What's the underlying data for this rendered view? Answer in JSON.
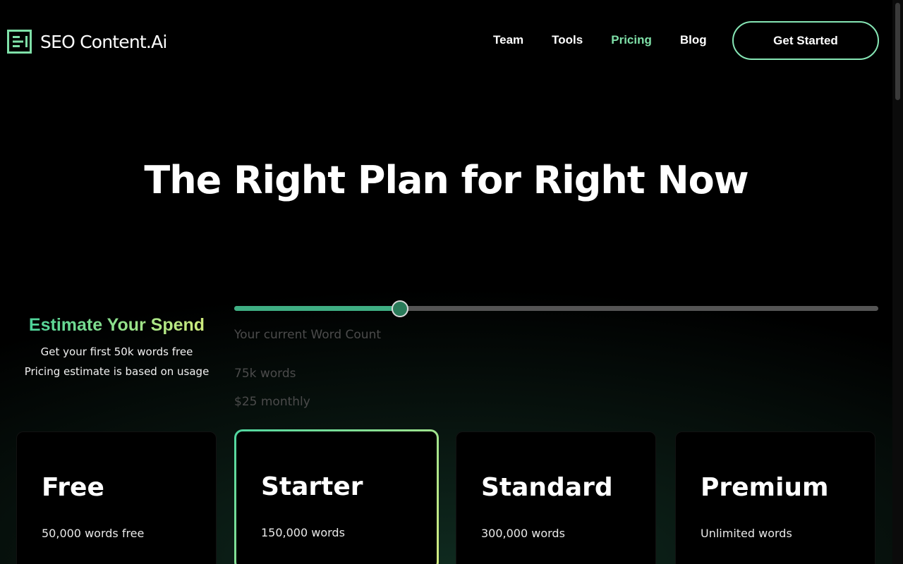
{
  "brand": {
    "name": "SEO Content.Ai",
    "accent": "#7fe0a8",
    "gradient_start": "#4dd39a",
    "gradient_end": "#cfec7e"
  },
  "nav": {
    "links": [
      {
        "label": "Team",
        "active": false
      },
      {
        "label": "Tools",
        "active": false
      },
      {
        "label": "Pricing",
        "active": true
      },
      {
        "label": "Blog",
        "active": false
      }
    ],
    "cta_label": "Get Started"
  },
  "hero": {
    "title": "The Right Plan for Right Now"
  },
  "estimate": {
    "title": "Estimate Your Spend",
    "line1": "Get your first 50k words free",
    "line2": "Pricing estimate is based on usage"
  },
  "slider": {
    "level_fraction": 0.257,
    "label": "Your current Word Count",
    "words": "75k words",
    "price": "$25 monthly"
  },
  "plans": [
    {
      "name": "Free",
      "words": "50,000 words free",
      "featured": false
    },
    {
      "name": "Starter",
      "words": "150,000 words",
      "featured": true
    },
    {
      "name": "Standard",
      "words": "300,000 words",
      "featured": false
    },
    {
      "name": "Premium",
      "words": "Unlimited words",
      "featured": false
    }
  ]
}
